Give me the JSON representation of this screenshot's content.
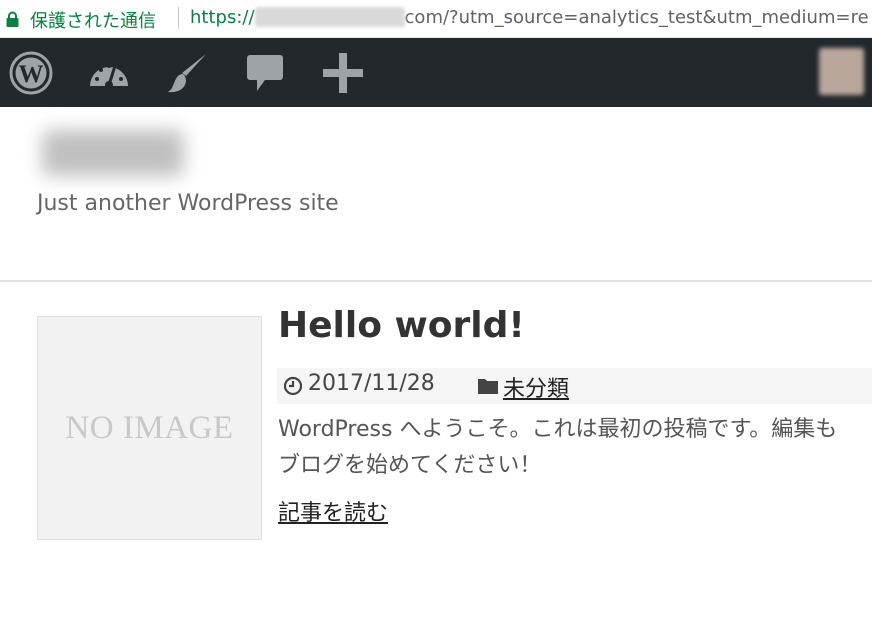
{
  "address_bar": {
    "secure_label": "保護された通信",
    "url_scheme": "https://",
    "url_rest": "com/?utm_source=analytics_test&utm_medium=re"
  },
  "admin_bar": {
    "background": "#23282d",
    "icon_color": "#9ea3a8",
    "items": [
      "wordpress-logo-icon",
      "dashboard-icon",
      "customize-brush-icon",
      "comments-icon",
      "new-content-plus-icon"
    ]
  },
  "site": {
    "description": "Just another WordPress site"
  },
  "post": {
    "thumbnail_text": "NO IMAGE",
    "title": "Hello world!",
    "date": "2017/11/28",
    "category": "未分類",
    "excerpt_line1": "WordPress へようこそ。これは最初の投稿です。編集も",
    "excerpt_line2": "ブログを始めてください！",
    "read_more": "記事を読む"
  }
}
